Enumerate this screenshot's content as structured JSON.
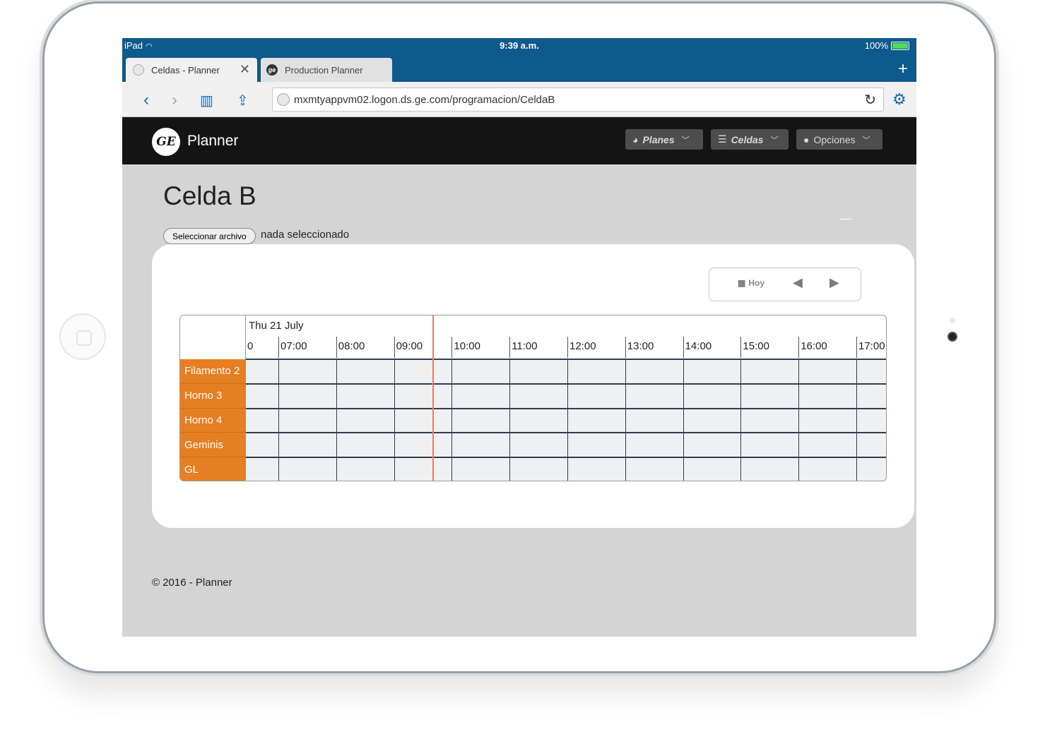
{
  "status_bar": {
    "device": "iPad",
    "time": "9:39 a.m.",
    "battery": "100%"
  },
  "browser": {
    "tabs": [
      {
        "label": "Celdas - Planner",
        "icon": "globe-icon",
        "active": true
      },
      {
        "label": "Production Planner",
        "icon": "ge-icon",
        "active": false
      }
    ],
    "url": "mxmtyappvm02.logon.ds.ge.com/programacion/CeldaB"
  },
  "navbar": {
    "brand": "Planner",
    "logo_text": "GE",
    "menus": [
      {
        "label": "Planes",
        "icon": "dashboard-icon"
      },
      {
        "label": "Celdas",
        "icon": "list-icon"
      },
      {
        "label": "Opciones",
        "icon": "user-icon"
      }
    ]
  },
  "page": {
    "title": "Celda B",
    "file_button": "Seleccionar archivo",
    "file_status": "nada seleccionado"
  },
  "scheduler": {
    "today_button": "Hoy",
    "date_label": "Thu 21 July",
    "partial_first_hour": "0",
    "hours": [
      "07:00",
      "08:00",
      "09:00",
      "10:00",
      "11:00",
      "12:00",
      "13:00",
      "14:00",
      "15:00",
      "16:00",
      "17:00"
    ],
    "resources": [
      "Filamento 2",
      "Horno 3",
      "Horno 4",
      "Geminis",
      "GL"
    ],
    "current_time_fraction_of_hour_after_0900": 0.67,
    "colors": {
      "resource": "#e67e22",
      "now_line": "#f07a68",
      "grid": "#2f3d4f"
    }
  },
  "footer": {
    "text": "© 2016 - Planner"
  }
}
